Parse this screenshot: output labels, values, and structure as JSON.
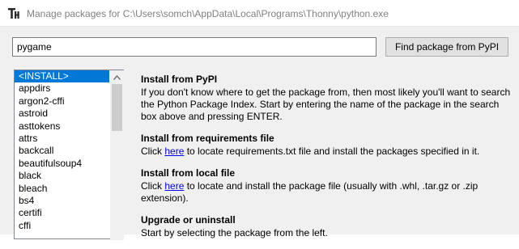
{
  "window": {
    "title": "Manage packages for C:\\Users\\somch\\AppData\\Local\\Programs\\Thonny\\python.exe"
  },
  "search": {
    "value": "pygame",
    "button_label": "Find package from PyPI"
  },
  "package_list": {
    "items": [
      "<INSTALL>",
      "appdirs",
      "argon2-cffi",
      "astroid",
      "asttokens",
      "attrs",
      "backcall",
      "beautifulsoup4",
      "black",
      "bleach",
      "bs4",
      "certifi",
      "cffi"
    ],
    "selected_index": 0
  },
  "info": {
    "pypi": {
      "title": "Install from PyPI",
      "body": "If you don't know where to get the package from, then most likely you'll want to search the Python Package Index. Start by entering the name of the package in the search box above and pressing ENTER."
    },
    "requirements": {
      "title": "Install from requirements file",
      "before_link": "Click ",
      "link": "here",
      "after_link": " to locate requirements.txt file and install the packages specified in it."
    },
    "local": {
      "title": "Install from local file",
      "before_link": "Click ",
      "link": "here",
      "after_link": " to locate and install the package file (usually with .whl, .tar.gz or .zip extension)."
    },
    "upgrade": {
      "title": "Upgrade or uninstall",
      "body": "Start by selecting the package from the left."
    }
  },
  "colors": {
    "selection": "#0078d7",
    "link": "#0000ee"
  }
}
